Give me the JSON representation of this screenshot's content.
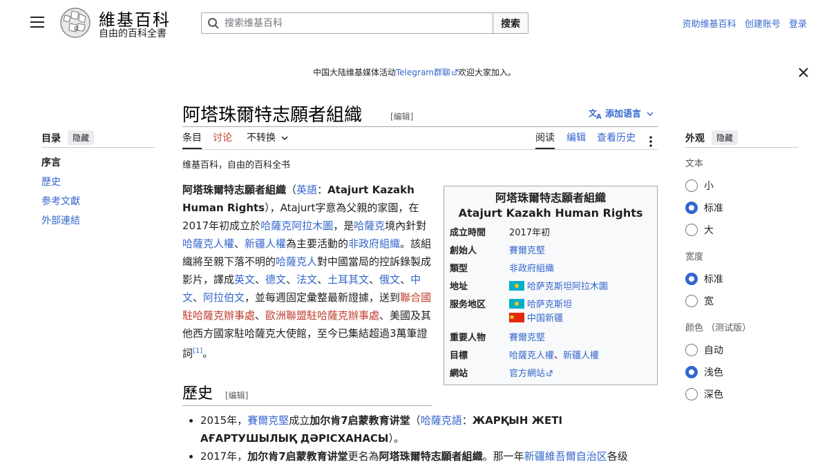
{
  "header": {
    "site_name": "維基百科",
    "tagline": "自由的百科全書",
    "search_placeholder": "搜索维基百科",
    "search_button": "搜索",
    "user_links": [
      "资助维基百科",
      "创建账号",
      "登录"
    ]
  },
  "banner": {
    "prefix": "中国大陆维基媒体活动",
    "link": "Telegram群聊",
    "suffix": "欢迎大家加入。"
  },
  "article": {
    "title": "阿塔珠爾特志願者組織",
    "edit_label": "[编辑]",
    "add_languages": "添加语言",
    "tabs_left": [
      "条目",
      "讨论",
      "不转换"
    ],
    "tabs_right": [
      "阅读",
      "编辑",
      "查看历史"
    ],
    "tagline": "维基百科，自由的百科全书"
  },
  "lead": {
    "t1": "阿塔珠爾特志願者組織",
    "t2": "（",
    "t3": "英語",
    "t4": "：",
    "t5": "Atajurt Kazakh Human Rights",
    "t6": "），Atajurt字意為父親的家園，在2017年初成立於",
    "t7": "哈薩克",
    "t8": "阿拉木圖",
    "t9": "，是",
    "t10": "哈薩克",
    "t11": "境內針對",
    "t12": "哈薩克人權",
    "t13": "、",
    "t14": "新疆人權",
    "t15": "為主要活動的",
    "t16": "非政府組織",
    "t17": "。該組織將至親下落不明的",
    "t18": "哈薩克人",
    "t19": "對中國當局的控訴錄製成影片，譯成",
    "t20": "英文",
    "t21": "、",
    "t22": "德文",
    "t23": "、",
    "t24": "法文",
    "t25": "、",
    "t26": "土耳其文",
    "t27": "、",
    "t28": "俄文",
    "t29": "、",
    "t30": "中文",
    "t31": "、",
    "t32": "阿拉伯文",
    "t33": "，並每週固定彙整最新證據，送到",
    "t34": "聯合國駐哈薩克辦事處",
    "t35": "、",
    "t36": "歐洲聯盟駐哈薩克辦事處",
    "t37": "、美國及其他西方國家駐哈薩克大使館，至今已集結超過3萬筆證詞",
    "t38": "[1]",
    "t39": "。"
  },
  "infobox": {
    "title1": "阿塔珠爾特志願者組織",
    "title2": "Atajurt Kazakh Human Rights",
    "rows": [
      {
        "label": "成立時間",
        "value": "2017年初"
      },
      {
        "label": "創始人",
        "value": "賽爾克堅"
      },
      {
        "label": "類型",
        "value": "非政府組織"
      },
      {
        "label": "地址",
        "value": "哈萨克斯坦阿拉木圖"
      },
      {
        "label": "服务地区",
        "value": "哈萨克斯坦",
        "value2": "中国新疆"
      },
      {
        "label": "重要人物",
        "value": "賽爾克堅"
      },
      {
        "label": "目標",
        "value": "哈薩克人權",
        "sep": "、",
        "value2": "新疆人權"
      },
      {
        "label": "網站",
        "value": "官方網站"
      }
    ]
  },
  "history": {
    "heading": "歷史",
    "edit_label": "[编辑]",
    "item1": {
      "a": "2015年，",
      "b": "賽爾克堅",
      "c": "成立",
      "d": "加尔肯7启蒙教育讲堂",
      "e": "（",
      "f": "哈薩克語",
      "g": "：",
      "h": "ЖАРҚЫН ЖЕТІ АҒАРТУШЫЛЫҚ ДӘРІСХАНАСЫ",
      "i": "）。"
    },
    "item2": {
      "a": "2017年，",
      "b": "加尔肯7启蒙教育讲堂",
      "c": "更名為",
      "d": "阿塔珠爾特志願者組織",
      "e": "。那一年",
      "f": "新疆維吾爾自治区",
      "g": "各级"
    }
  },
  "toc": {
    "title": "目录",
    "hide": "隐藏",
    "items": [
      "序言",
      "歷史",
      "参考文獻",
      "外部連結"
    ]
  },
  "appearance": {
    "title": "外观",
    "hide": "隐藏",
    "text_label": "文本",
    "text_options": [
      "小",
      "标准",
      "大"
    ],
    "text_selected": "标准",
    "width_label": "宽度",
    "width_options": [
      "标准",
      "宽"
    ],
    "width_selected": "标准",
    "color_label": "颜色 （测试版）",
    "color_options": [
      "自动",
      "浅色",
      "深色"
    ],
    "color_selected": "浅色"
  },
  "colors": {
    "link": "#3366cc",
    "redlink": "#bf3c2c",
    "accent": "#3366cc"
  }
}
